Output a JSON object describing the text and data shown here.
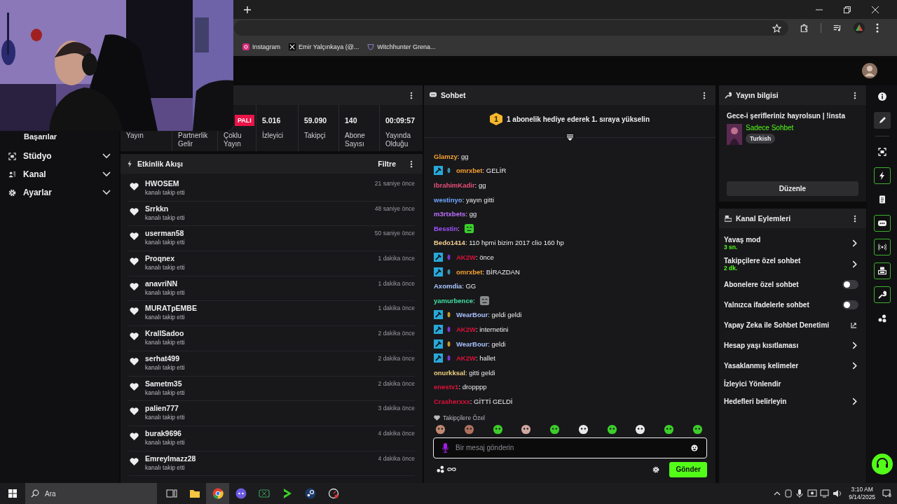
{
  "browser": {
    "bookmarks": [
      {
        "label": "Instagram",
        "kind": "instagram"
      },
      {
        "label": "Emir Yalçınkaya (@...",
        "kind": "x"
      },
      {
        "label": "Witchhunter Grena...",
        "kind": "shield"
      }
    ]
  },
  "sidebar": {
    "items": [
      {
        "label": "Başarılar",
        "kind": "label"
      },
      {
        "label": "Stüdyo",
        "kind": "studio",
        "expanded": false
      },
      {
        "label": "Kanal",
        "kind": "channel",
        "expanded": false
      },
      {
        "label": "Ayarlar",
        "kind": "settings",
        "expanded": false
      }
    ]
  },
  "stats": {
    "cells": [
      {
        "label": "Yayın"
      },
      {
        "label": "Partnerlik Gelir"
      },
      {
        "label": "Çoklu Yayın",
        "badge": "PALI"
      },
      {
        "value": "5.016",
        "label": "İzleyici"
      },
      {
        "value": "59.090",
        "label": "Takipçi"
      },
      {
        "value": "140",
        "label": "Abone Sayısı"
      },
      {
        "value": "00:09:57",
        "label": "Yayında Olduğu"
      }
    ]
  },
  "events": {
    "title": "Etkinlik Akışı",
    "filter": "Filtre",
    "items": [
      {
        "user": "HWOSEM",
        "action": "kanalı takip etti",
        "time": "21 saniye önce"
      },
      {
        "user": "Srrkkn",
        "action": "kanalı takip etti",
        "time": "48 saniye önce"
      },
      {
        "user": "userman58",
        "action": "kanalı takip etti",
        "time": "50 saniye önce"
      },
      {
        "user": "Proqnex",
        "action": "kanalı takip etti",
        "time": "1 dakika önce"
      },
      {
        "user": "anavriNN",
        "action": "kanalı takip etti",
        "time": "1 dakika önce"
      },
      {
        "user": "MURATpEMBE",
        "action": "kanalı takip etti",
        "time": "1 dakika önce"
      },
      {
        "user": "KrallSadoo",
        "action": "kanalı takip etti",
        "time": "2 dakika önce"
      },
      {
        "user": "serhat499",
        "action": "kanalı takip etti",
        "time": "2 dakika önce"
      },
      {
        "user": "Sametm35",
        "action": "kanalı takip etti",
        "time": "2 dakika önce"
      },
      {
        "user": "palien777",
        "action": "kanalı takip etti",
        "time": "3 dakika önce"
      },
      {
        "user": "burak9696",
        "action": "kanalı takip etti",
        "time": "4 dakika önce"
      },
      {
        "user": "Emreylmazz28",
        "action": "kanalı takip etti",
        "time": "4 dakika önce"
      }
    ]
  },
  "chat": {
    "title": "Sohbet",
    "banner": {
      "rank": "1",
      "text": "1 abonelik hediye ederek 1. sıraya yükselin"
    },
    "messages": [
      {
        "user": "Glamzy",
        "color": "#f5a030",
        "text": ": gg"
      },
      {
        "badges": [
          {
            "kind": "moderator"
          },
          {
            "kind": "sub",
            "color": "#3a8fb0"
          }
        ],
        "user": "omrxbet",
        "color": "#f5a030",
        "text": ": GELİR"
      },
      {
        "user": "IbrahimKadir",
        "color": "#e8507a",
        "text": ": gg"
      },
      {
        "user": "westinyo",
        "color": "#6fa8ff",
        "text": ": yayın gitti"
      },
      {
        "user": "m3rtxbets",
        "color": "#c070ff",
        "text": ": gg"
      },
      {
        "user": "Besstin",
        "color": "#a050ff",
        "text": ":",
        "emote": {
          "color": "#3ccf2a"
        }
      },
      {
        "user": "Bedo1414",
        "color": "#f5d090",
        "text": ": 110 hpmi bizim 2017 clio 160 hp"
      },
      {
        "badges": [
          {
            "kind": "moderator"
          },
          {
            "kind": "sub",
            "color": "#7a3ad0"
          }
        ],
        "user": "AK2W",
        "color": "#e0103a",
        "text": ": önce"
      },
      {
        "badges": [
          {
            "kind": "moderator"
          },
          {
            "kind": "sub",
            "color": "#3a8fb0"
          }
        ],
        "user": "omrxbet",
        "color": "#f5a030",
        "text": ": BİRAZDAN"
      },
      {
        "user": "Axomdia",
        "color": "#a8c8ff",
        "text": ": GG"
      },
      {
        "user": "yamurbence",
        "color": "#40e0a0",
        "text": ":",
        "emote": {
          "color": "#8a8a8a"
        }
      },
      {
        "badges": [
          {
            "kind": "moderator"
          },
          {
            "kind": "sub",
            "color": "#c89a30"
          }
        ],
        "user": "WearBour",
        "color": "#a8c0ff",
        "text": ": geldi geldi"
      },
      {
        "badges": [
          {
            "kind": "moderator"
          },
          {
            "kind": "sub",
            "color": "#7a3ad0"
          }
        ],
        "user": "AK2W",
        "color": "#e0103a",
        "text": ": internetini"
      },
      {
        "badges": [
          {
            "kind": "moderator"
          },
          {
            "kind": "sub",
            "color": "#c89a30"
          }
        ],
        "user": "WearBour",
        "color": "#a8c0ff",
        "text": ": geldi"
      },
      {
        "badges": [
          {
            "kind": "moderator"
          },
          {
            "kind": "sub",
            "color": "#7a3ad0"
          }
        ],
        "user": "AK2W",
        "color": "#e0103a",
        "text": ": hallet"
      },
      {
        "user": "onurkksal",
        "color": "#f0d080",
        "text": ": gitti geldi"
      },
      {
        "user": "enestv1",
        "color": "#e0103a",
        "text": ": dropppp"
      },
      {
        "user": "Crasherxxx",
        "color": "#e0103a",
        "text": ": GİTTİ GELDİ"
      }
    ],
    "emote_section": "Takipçilere Özel",
    "emotes": [
      {
        "color": "#c08870"
      },
      {
        "color": "#b07060"
      },
      {
        "color": "#3ccf2a"
      },
      {
        "color": "#d0a8a0"
      },
      {
        "color": "#3ccf2a"
      },
      {
        "color": "#e8e8e8"
      },
      {
        "color": "#3ccf2a"
      },
      {
        "color": "#e8e8e8"
      },
      {
        "color": "#3ccf2a"
      },
      {
        "color": "#3ccf2a"
      }
    ],
    "input": {
      "placeholder": "Bir mesaj gönderin"
    },
    "send": "Gönder"
  },
  "stream_info": {
    "title": "Yayın bilgisi",
    "stream_title": "Gece-i şerifleriniz hayrolsun | !insta",
    "category": "Sadece Sohbet",
    "tag": "Turkish",
    "edit": "Düzenle"
  },
  "actions": {
    "title": "Kanal Eylemleri",
    "items": [
      {
        "label": "Yavaş mod",
        "sub": "3 sn.",
        "kind": "chevron"
      },
      {
        "label": "Takipçilere özel sohbet",
        "sub": "2 dk.",
        "kind": "chevron"
      },
      {
        "label": "Abonelere özel sohbet",
        "kind": "toggle",
        "on": false
      },
      {
        "label": "Yalnızca ifadelerle sohbet",
        "kind": "toggle",
        "on": false
      },
      {
        "label": "Yapay Zeka ile Sohbet Denetimi",
        "kind": "external"
      },
      {
        "label": "Hesap yaşı kısıtlaması",
        "kind": "chevron"
      },
      {
        "label": "Yasaklanmış kelimeler",
        "kind": "chevron"
      },
      {
        "label": "İzleyici Yönlendir",
        "kind": "plain"
      },
      {
        "label": "Hedefleri belirleyin",
        "kind": "chevron"
      }
    ]
  },
  "rail": [
    {
      "kind": "info",
      "selected": false,
      "on": false
    },
    {
      "kind": "pencil",
      "selected": true,
      "on": false
    },
    {
      "kind": "screen",
      "selected": false,
      "on": false
    },
    {
      "kind": "bolt",
      "selected": false,
      "on": true
    },
    {
      "kind": "doc",
      "selected": false,
      "on": false
    },
    {
      "kind": "chat",
      "selected": false,
      "on": true
    },
    {
      "kind": "broadcast",
      "selected": false,
      "on": true
    },
    {
      "kind": "layout",
      "selected": false,
      "on": true
    },
    {
      "kind": "wrench",
      "selected": false,
      "on": true
    },
    {
      "kind": "dots",
      "selected": false,
      "on": false
    }
  ],
  "taskbar": {
    "search_placeholder": "Ara",
    "apps": [
      {
        "kind": "taskview",
        "selected": false
      },
      {
        "kind": "folder",
        "selected": false
      },
      {
        "kind": "chrome",
        "selected": true
      },
      {
        "kind": "discord",
        "selected": false
      },
      {
        "kind": "xbox",
        "selected": false
      },
      {
        "kind": "arrow",
        "selected": false
      },
      {
        "kind": "steam",
        "selected": false
      },
      {
        "kind": "gauge",
        "selected": false
      }
    ],
    "time": "3:10 AM",
    "date": "9/14/2025",
    "notifications": "5"
  }
}
